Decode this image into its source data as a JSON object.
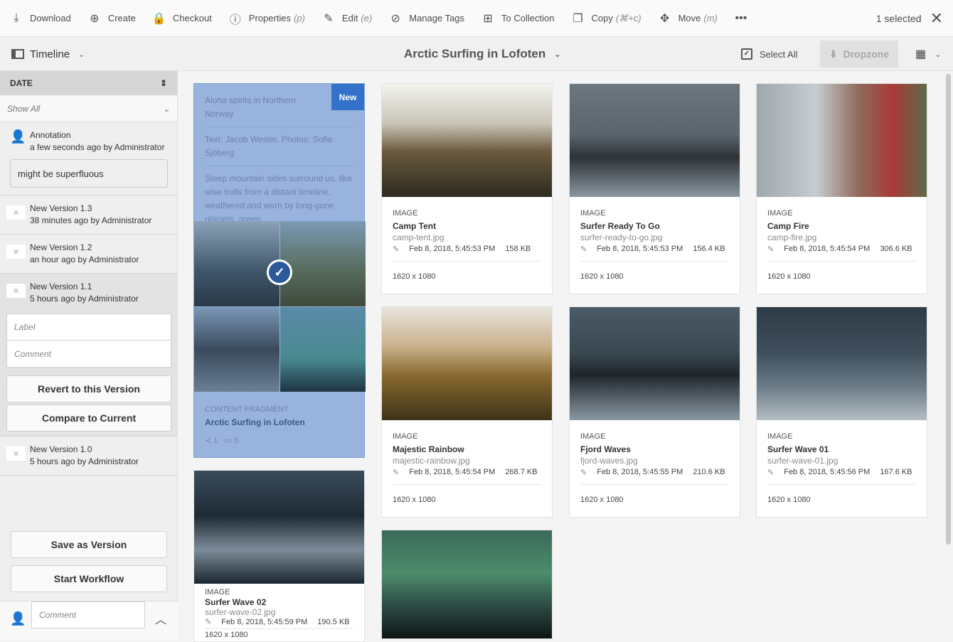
{
  "toolbar": {
    "items": [
      {
        "label": "Download",
        "icon": "download-icon",
        "glyph": "⤓",
        "shortcut": ""
      },
      {
        "label": "Create",
        "icon": "plus-circle-icon",
        "glyph": "⊕",
        "shortcut": ""
      },
      {
        "label": "Checkout",
        "icon": "lock-icon",
        "glyph": "🔒",
        "shortcut": ""
      },
      {
        "label": "Properties",
        "icon": "info-icon",
        "glyph": "ⓘ",
        "shortcut": "(p)"
      },
      {
        "label": "Edit",
        "icon": "pencil-icon",
        "glyph": "✎",
        "shortcut": "(e)"
      },
      {
        "label": "Manage Tags",
        "icon": "tag-icon",
        "glyph": "⊘",
        "shortcut": ""
      },
      {
        "label": "To Collection",
        "icon": "collection-icon",
        "glyph": "⊞",
        "shortcut": ""
      },
      {
        "label": "Copy",
        "icon": "copy-icon",
        "glyph": "❐",
        "shortcut": "(⌘+c)"
      },
      {
        "label": "Move",
        "icon": "move-icon",
        "glyph": "✥",
        "shortcut": "(m)"
      },
      {
        "label": "",
        "icon": "more-icon",
        "glyph": "•••",
        "shortcut": ""
      }
    ],
    "selected": "1 selected"
  },
  "header": {
    "rail": "Timeline",
    "title": "Arctic Surfing in Lofoten",
    "select_all": "Select All",
    "dropzone": "Dropzone"
  },
  "sidebar": {
    "sort": "DATE",
    "filter": "Show All",
    "annotation": {
      "title": "Annotation",
      "sub": "a few seconds ago by Administrator",
      "note": "might be superfluous"
    },
    "versions": [
      {
        "title": "New Version 1.3",
        "sub": "38 minutes ago by Administrator"
      },
      {
        "title": "New Version 1.2",
        "sub": "an hour ago by Administrator"
      },
      {
        "title": "New Version 1.1",
        "sub": "5 hours ago by Administrator"
      }
    ],
    "label_placeholder": "Label",
    "comment_placeholder": "Comment",
    "revert": "Revert to this Version",
    "compare": "Compare to Current",
    "v10": {
      "title": "New Version 1.0",
      "sub": "5 hours ago by Administrator"
    },
    "save": "Save as Version",
    "workflow": "Start Workflow",
    "comment": "Comment"
  },
  "fragment": {
    "badge": "New",
    "title_line": "Aloha spirits in Northern Norway",
    "credit": "Text: Jacob Wester. Photos: Sofia Sjöberg",
    "excerpt": "Steep mountain sides surround us, like wise trolls from a distant timeline, weathered and worn by long-gone glaciers, green...",
    "type": "CONTENT FRAGMENT",
    "name": "Arctic Surfing in Lofoten",
    "shares": "1",
    "images": "5"
  },
  "cards": [
    {
      "type": "IMAGE",
      "name": "Camp Tent",
      "file": "camp-tent.jpg",
      "date": "Feb 8, 2018, 5:45:53 PM",
      "size": "158 KB",
      "dims": "1620 x 1080",
      "bg": "linear-gradient(180deg,#f4f4f0 0%,#c9c4b8 35%,#6b5a3c 60%,#2d2a1f 100%)"
    },
    {
      "type": "IMAGE",
      "name": "Surfer Ready To Go",
      "file": "surfer-ready-to-go.jpg",
      "date": "Feb 8, 2018, 5:45:53 PM",
      "size": "156.4 KB",
      "dims": "1620 x 1080",
      "bg": "linear-gradient(180deg,#6c7780 0%,#5a646c 45%,#2d3236 65%,#8a97a0 100%)"
    },
    {
      "type": "IMAGE",
      "name": "Camp Fire",
      "file": "camp-fire.jpg",
      "date": "Feb 8, 2018, 5:45:54 PM",
      "size": "306.6 KB",
      "dims": "1620 x 1080",
      "bg": "linear-gradient(90deg,#9ea8ad 0%,#c7ccd0 35%,#8e6a5a 60%,#a83a38 80%,#5e6b4a 100%)"
    },
    {
      "type": "IMAGE",
      "name": "Majestic Rainbow",
      "file": "majestic-rainbow.jpg",
      "date": "Feb 8, 2018, 5:45:54 PM",
      "size": "268.7 KB",
      "dims": "1620 x 1080",
      "bg": "linear-gradient(180deg,#e9e5de 0%,#c8b08a 35%,#8a6a30 60%,#3c3418 100%)"
    },
    {
      "type": "IMAGE",
      "name": "Fjord Waves",
      "file": "fjord-waves.jpg",
      "date": "Feb 8, 2018, 5:45:55 PM",
      "size": "210.6 KB",
      "dims": "1620 x 1080",
      "bg": "linear-gradient(180deg,#4a5a66 0%,#3a4852 40%,#1e262c 60%,#8a98a2 100%)"
    },
    {
      "type": "IMAGE",
      "name": "Surfer Wave 01",
      "file": "surfer-wave-01.jpg",
      "date": "Feb 8, 2018, 5:45:56 PM",
      "size": "167.6 KB",
      "dims": "1620 x 1080",
      "bg": "linear-gradient(180deg,#2e3c48 0%,#3e4e5a 40%,#6a7a86 70%,#b4bec4 100%)"
    },
    {
      "type": "IMAGE",
      "name": "Surfer Wave 02",
      "file": "surfer-wave-02.jpg",
      "date": "Feb 8, 2018, 5:45:59 PM",
      "size": "190.5 KB",
      "dims": "1620 x 1080",
      "bg": "linear-gradient(180deg,#3a4c5c 0%,#1e2a34 40%,#7c8c98 70%,#1a2630 100%)"
    },
    {
      "type": "",
      "name": "",
      "file": "",
      "date": "",
      "size": "",
      "dims": "",
      "bg": "linear-gradient(180deg,#3a6a5a 0%,#4c8c6c 40%,#2c4a44 70%,#0e1614 100%)"
    }
  ]
}
